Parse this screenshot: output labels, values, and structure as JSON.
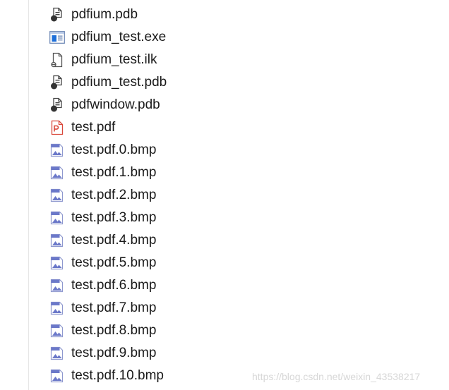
{
  "files": [
    {
      "name": "pdfium.pdb",
      "icon": "pdb-file-icon"
    },
    {
      "name": "pdfium_test.exe",
      "icon": "exe-file-icon"
    },
    {
      "name": "pdfium_test.ilk",
      "icon": "ilk-file-icon"
    },
    {
      "name": "pdfium_test.pdb",
      "icon": "pdb-file-icon"
    },
    {
      "name": "pdfwindow.pdb",
      "icon": "pdb-file-icon"
    },
    {
      "name": "test.pdf",
      "icon": "pdf-file-icon"
    },
    {
      "name": "test.pdf.0.bmp",
      "icon": "bmp-file-icon"
    },
    {
      "name": "test.pdf.1.bmp",
      "icon": "bmp-file-icon"
    },
    {
      "name": "test.pdf.2.bmp",
      "icon": "bmp-file-icon"
    },
    {
      "name": "test.pdf.3.bmp",
      "icon": "bmp-file-icon"
    },
    {
      "name": "test.pdf.4.bmp",
      "icon": "bmp-file-icon"
    },
    {
      "name": "test.pdf.5.bmp",
      "icon": "bmp-file-icon"
    },
    {
      "name": "test.pdf.6.bmp",
      "icon": "bmp-file-icon"
    },
    {
      "name": "test.pdf.7.bmp",
      "icon": "bmp-file-icon"
    },
    {
      "name": "test.pdf.8.bmp",
      "icon": "bmp-file-icon"
    },
    {
      "name": "test.pdf.9.bmp",
      "icon": "bmp-file-icon"
    },
    {
      "name": "test.pdf.10.bmp",
      "icon": "bmp-file-icon"
    }
  ],
  "watermark": "https://blog.csdn.net/weixin_43538217",
  "colors": {
    "text": "#1a1a1a",
    "pdf_icon": "#d9483b",
    "exe_icon": "#1e6fd9",
    "bmp_icon": "#6b78c9",
    "pdb_icon": "#3a3a3a"
  }
}
